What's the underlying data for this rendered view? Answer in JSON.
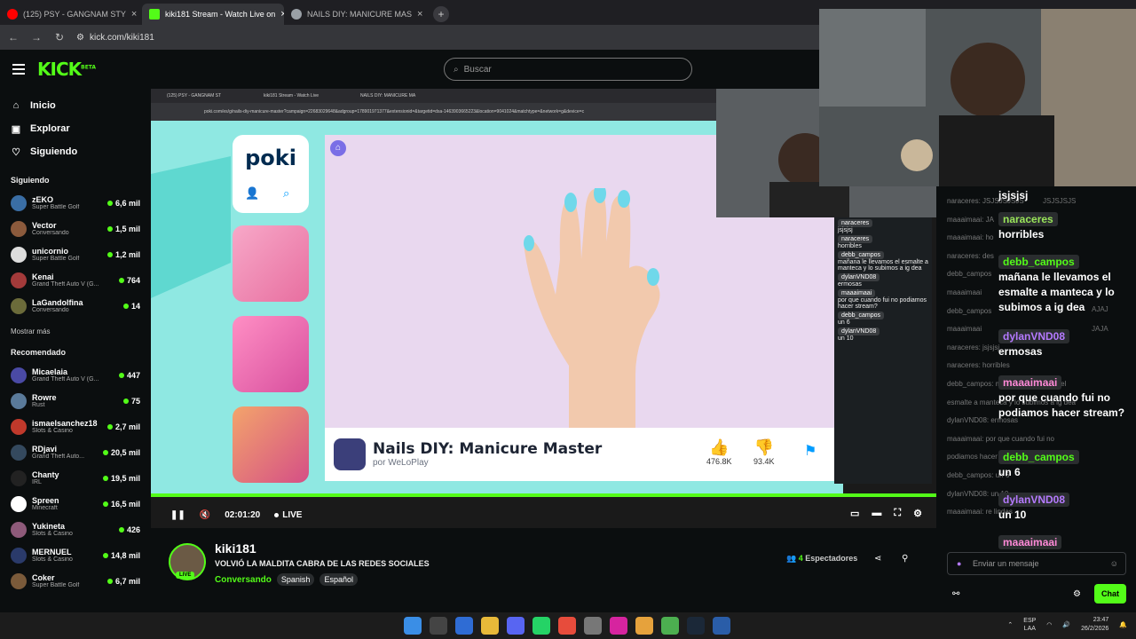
{
  "browser": {
    "tabs": [
      {
        "label": "(125) PSY - GANGNAM STY",
        "color": "#ff0000"
      },
      {
        "label": "kiki181 Stream - Watch Live on",
        "color": "#53fc18"
      },
      {
        "label": "NAILS DIY: MANICURE MAS",
        "color": "#9aa0a6"
      }
    ],
    "url": "kick.com/kiki181"
  },
  "header": {
    "logo": "KICK",
    "beta": "BETA",
    "search_placeholder": "Buscar"
  },
  "sidebar": {
    "nav": [
      {
        "label": "Inicio",
        "icon": "home-icon"
      },
      {
        "label": "Explorar",
        "icon": "compass-icon"
      },
      {
        "label": "Siguiendo",
        "icon": "heart-icon"
      }
    ],
    "following_title": "Siguiendo",
    "following": [
      {
        "name": "zEKO",
        "category": "Super Battle Golf",
        "viewers": "6,6 mil",
        "color": "#3a6ea5"
      },
      {
        "name": "Vector",
        "category": "Conversando",
        "viewers": "1,5 mil",
        "color": "#8b5a3c"
      },
      {
        "name": "unicornio",
        "category": "Super Battle Golf",
        "viewers": "1,2 mil",
        "color": "#dddddd"
      },
      {
        "name": "Kenai",
        "category": "Grand Theft Auto V (G...",
        "viewers": "764",
        "color": "#a33a3a"
      },
      {
        "name": "LaGandolfina",
        "category": "Conversando",
        "viewers": "14",
        "color": "#6b6b3a"
      }
    ],
    "show_more": "Mostrar más",
    "recommended_title": "Recomendado",
    "recommended": [
      {
        "name": "Micaelaia",
        "category": "Grand Theft Auto V (G...",
        "viewers": "447",
        "color": "#4a4aa5"
      },
      {
        "name": "Rowre",
        "category": "Rust",
        "viewers": "75",
        "color": "#5a7a9a"
      },
      {
        "name": "ismaelsanchez18",
        "category": "Slots & Casino",
        "viewers": "2,7 mil",
        "color": "#c0392b"
      },
      {
        "name": "RDjavi",
        "category": "Grand Theft Auto...",
        "viewers": "20,5 mil",
        "color": "#34495e"
      },
      {
        "name": "Chanty",
        "category": "IRL",
        "viewers": "19,5 mil",
        "color": "#222222"
      },
      {
        "name": "Spreen",
        "category": "Minecraft",
        "viewers": "16,5 mil",
        "color": "#ffffff"
      },
      {
        "name": "Yukineta",
        "category": "Slots & Casino",
        "viewers": "426",
        "color": "#8e5a7a"
      },
      {
        "name": "MERNUEL",
        "category": "Slots & Casino",
        "viewers": "14,8 mil",
        "color": "#2a3a6a"
      },
      {
        "name": "Coker",
        "category": "Super Battle Golf",
        "viewers": "6,7 mil",
        "color": "#7a5a3a"
      }
    ]
  },
  "player": {
    "inner_tabs": [
      "(125) PSY - GANGNAM ST",
      "kiki181 Stream - Watch Live",
      "NAILS DIY: MANICURE MA"
    ],
    "inner_url": "poki.com/es/g/nails-diy-manicure-master?campaign=22683029648&adgroup=178901971377&extensionid=&targetid=dsa-1463903665223&location=9041024&matchtype=&network=g&device=c",
    "poki_logo": "poki",
    "game_title": "Nails DIY: Manicure Master",
    "game_by": "por WeLoPlay",
    "likes": "476.8K",
    "dislikes": "93.4K",
    "time": "02:01:20",
    "live": "LIVE"
  },
  "inner_chat": [
    {
      "user": "naraceres",
      "msg": "jsjsjsj"
    },
    {
      "user": "naraceres",
      "msg": "horribles"
    },
    {
      "user": "debb_campos",
      "msg": "mañana le llevamos el esmalte a manteca y lo subimos a ig dea"
    },
    {
      "user": "dylanVND08",
      "msg": "ermosas"
    },
    {
      "user": "maaaimaai",
      "msg": "por que cuando fui no podiamos hacer stream?"
    },
    {
      "user": "debb_campos",
      "msg": "un 6"
    },
    {
      "user": "dylanVND08",
      "msg": "un 10"
    }
  ],
  "chat": {
    "background_lines": [
      "naraceres: JSJSJSJSJS",
      "maaaimaai: JA",
      "maaaimaai: ho",
      "naraceres: des",
      "debb_campos",
      "maaaimaai",
      "debb_campos",
      "maaaimaai",
      "naraceres: jsjsjsj",
      "naraceres: horribles",
      "debb_campos: mañana le llevamos el",
      "esmalte a manteca y lo subimos a ig dea",
      "dylanVND08: ermosas",
      "maaaimaai: por que cuando fui no",
      "podiamos hacer stream?",
      "debb_campos: un 6",
      "dylanVND08: un 10",
      "maaaimaai: re lindas"
    ],
    "messages": [
      {
        "user": "",
        "text": "jsjsjsj"
      },
      {
        "user": "naraceres",
        "text": "horribles",
        "color": "#9ae65a"
      },
      {
        "user": "debb_campos",
        "text": "mañana le llevamos el esmalte a manteca y lo subimos a ig dea",
        "color": "#53fc18"
      },
      {
        "user": "dylanVND08",
        "text": "ermosas",
        "color": "#b57aff"
      },
      {
        "user": "maaaimaai",
        "text": "por que cuando fui no podiamos hacer stream?",
        "color": "#ff8ad8"
      },
      {
        "user": "debb_campos",
        "text": "un 6",
        "color": "#53fc18"
      },
      {
        "user": "dylanVND08",
        "text": "un 10",
        "color": "#b57aff"
      },
      {
        "user": "maaaimaai",
        "text": "re lindas",
        "color": "#ff8ad8"
      }
    ],
    "overlay_texts": [
      "JSJSJSJS",
      "AJAJ",
      "JAJA"
    ],
    "input_placeholder": "Enviar un mensaje",
    "send_label": "Chat"
  },
  "streamer": {
    "name": "kiki181",
    "title": "VOLVIÓ LA MALDITA CABRA DE LAS REDES SOCIALES",
    "category": "Conversando",
    "tags": [
      "Spanish",
      "Español"
    ],
    "live": "LIVE",
    "viewers_count": "4",
    "viewers_label": "Espectadores"
  },
  "taskbar": {
    "lang": "ESP",
    "region": "LAA",
    "time": "23:47",
    "date": "26/2/2026"
  }
}
